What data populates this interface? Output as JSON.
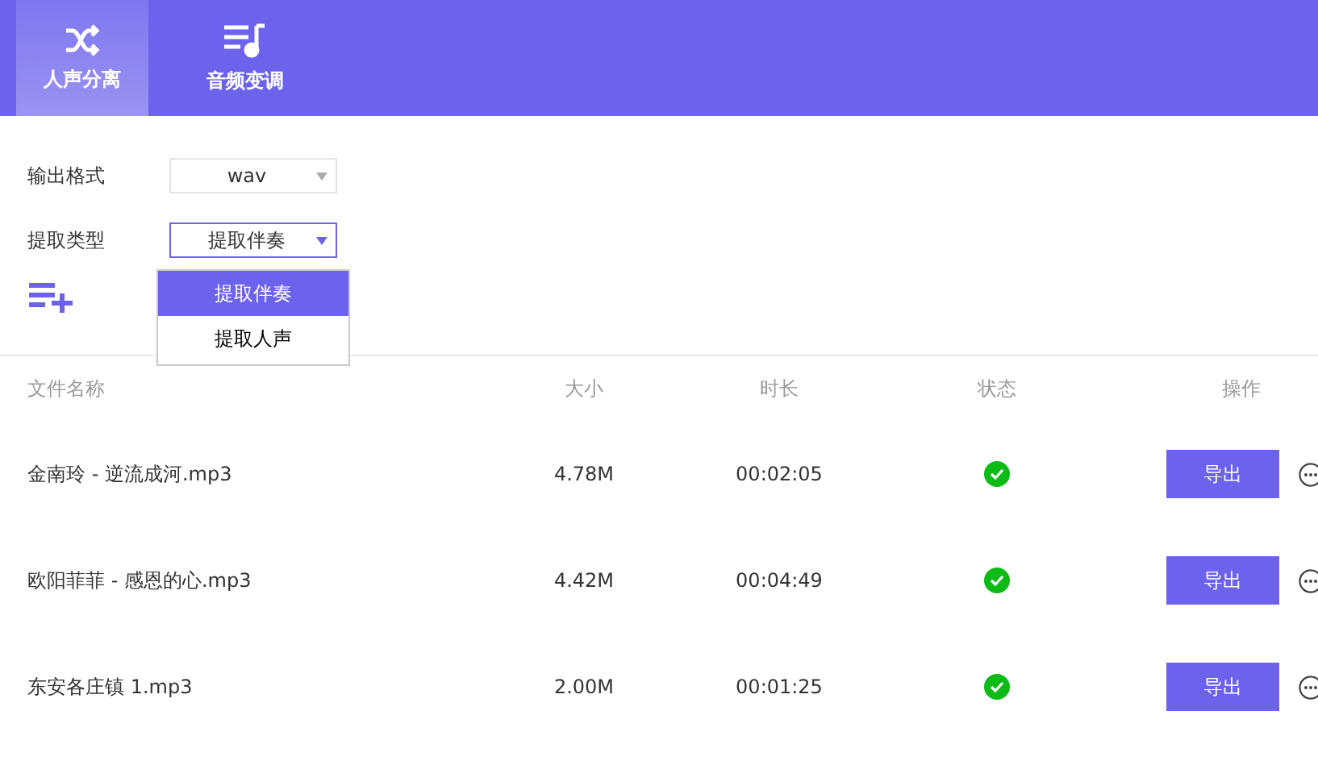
{
  "tabs": [
    {
      "label": "人声分离",
      "kind": "shuffle",
      "selected": true
    },
    {
      "label": "音频变调",
      "kind": "music",
      "selected": false
    }
  ],
  "form": [
    {
      "label": "输出格式",
      "value": "wav",
      "focused": false
    },
    {
      "label": "提取类型",
      "value": "提取伴奏",
      "focused": true,
      "open": true,
      "options": [
        {
          "label": "提取伴奏",
          "selected": true
        },
        {
          "label": "提取人声",
          "selected": false
        }
      ]
    }
  ],
  "table": {
    "columns": [
      "文件名称",
      "大小",
      "时长",
      "状态",
      "操作"
    ],
    "rows": [
      {
        "name": "金南玲 - 逆流成河.mp3",
        "size": "4.78M",
        "duration": "00:02:05",
        "done": true,
        "action": "导出"
      },
      {
        "name": "欧阳菲菲 - 感恩的心.mp3",
        "size": "4.42M",
        "duration": "00:04:49",
        "done": true,
        "action": "导出"
      },
      {
        "name": "东安各庄镇 1.mp3",
        "size": "2.00M",
        "duration": "00:01:25",
        "done": true,
        "action": "导出"
      }
    ]
  }
}
